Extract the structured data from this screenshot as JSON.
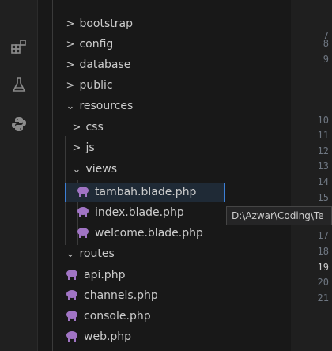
{
  "activity_bar": {
    "icons": [
      "extensions-icon",
      "testing-flask-icon",
      "python-icon"
    ]
  },
  "explorer": {
    "items": [
      {
        "label": "bootstrap",
        "type": "folder",
        "expanded": false
      },
      {
        "label": "config",
        "type": "folder",
        "expanded": false
      },
      {
        "label": "database",
        "type": "folder",
        "expanded": false
      },
      {
        "label": "public",
        "type": "folder",
        "expanded": false
      },
      {
        "label": "resources",
        "type": "folder",
        "expanded": true
      },
      {
        "label": "css",
        "type": "folder",
        "expanded": false
      },
      {
        "label": "js",
        "type": "folder",
        "expanded": false
      },
      {
        "label": "views",
        "type": "folder",
        "expanded": true
      },
      {
        "label": "tambah.blade.php",
        "type": "file",
        "selected": true
      },
      {
        "label": "index.blade.php",
        "type": "file"
      },
      {
        "label": "welcome.blade.php",
        "type": "file"
      },
      {
        "label": "routes",
        "type": "folder",
        "expanded": true
      },
      {
        "label": "api.php",
        "type": "file"
      },
      {
        "label": "channels.php",
        "type": "file"
      },
      {
        "label": "console.php",
        "type": "file"
      },
      {
        "label": "web.php",
        "type": "file"
      }
    ]
  },
  "tooltip": {
    "text": "D:\\Azwar\\Coding\\Te"
  },
  "editor": {
    "line_numbers": [
      "7",
      "8",
      "9",
      "10",
      "11",
      "12",
      "13",
      "14",
      "15",
      "16",
      "17",
      "18",
      "19",
      "20",
      "21"
    ],
    "active_line": "19"
  },
  "colors": {
    "php_icon": "#a074c4",
    "selection_border": "#3c7fd6"
  }
}
